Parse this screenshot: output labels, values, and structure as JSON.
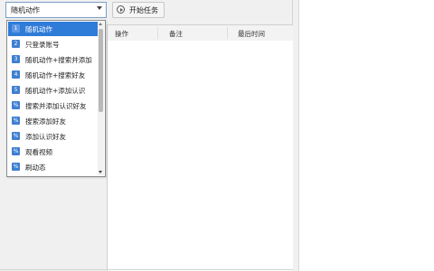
{
  "task_select": {
    "value": "随机动作"
  },
  "start_button": {
    "label": "开始任务"
  },
  "table": {
    "columns": [
      "操作",
      "备注",
      "最后时间"
    ]
  },
  "dropdown": {
    "items": [
      {
        "icon": "1",
        "label": "随机动作",
        "selected": true
      },
      {
        "icon": "2",
        "label": "只登录账号"
      },
      {
        "icon": "3",
        "label": "随机动作+搜索并添加"
      },
      {
        "icon": "4",
        "label": "随机动作+搜索好友"
      },
      {
        "icon": "5",
        "label": "随机动作+添加认识"
      },
      {
        "icon": "%",
        "label": "搜索并添加认识好友"
      },
      {
        "icon": "%",
        "label": "搜索添加好友"
      },
      {
        "icon": "%",
        "label": "添加认识好友"
      },
      {
        "icon": "%",
        "label": "观看视频"
      },
      {
        "icon": "%",
        "label": "刷动态"
      }
    ]
  },
  "colors": {
    "selection": "#2f7bd8",
    "item_icon": "#3f7fd1"
  }
}
